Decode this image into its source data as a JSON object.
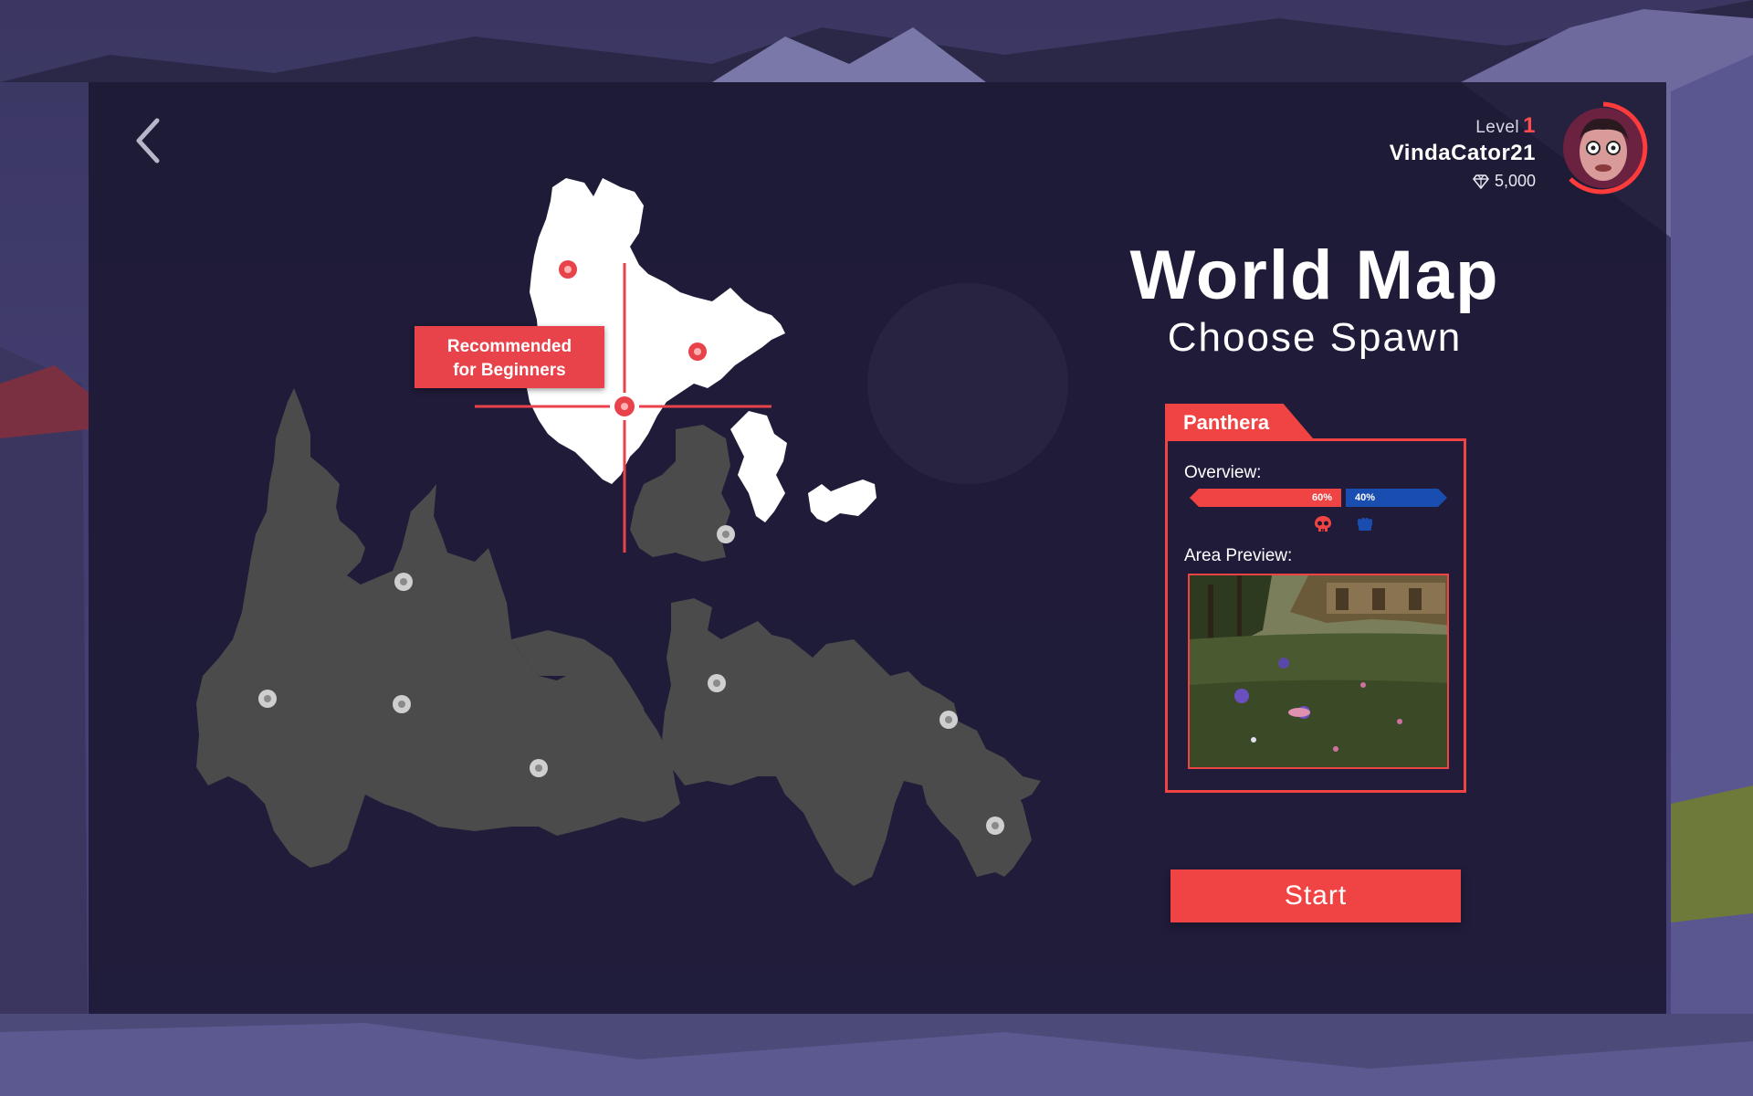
{
  "profile": {
    "level_label": "Level",
    "level_value": "1",
    "username": "VindaCator21",
    "gems": "5,000",
    "accent_color": "#ff4b4b"
  },
  "header": {
    "title": "World Map",
    "subtitle": "Choose Spawn"
  },
  "map": {
    "recommended_label_line1": "Recommended",
    "recommended_label_line2": "for Beginners",
    "selected_region_color": "#ffffff",
    "region_color": "#4b4b4b"
  },
  "region_card": {
    "name": "Panthera",
    "overview_label": "Overview:",
    "pvp_percent": "60%",
    "pve_percent": "40%",
    "pvp_fraction": 0.6,
    "pve_fraction": 0.4,
    "pvp_icon": "skull-icon",
    "pve_icon": "fist-icon",
    "preview_label": "Area Preview:"
  },
  "actions": {
    "start_label": "Start",
    "back_icon": "chevron-left-icon"
  },
  "colors": {
    "accent": "#f04343",
    "blue": "#1a4db0",
    "panel": "#1a1630"
  }
}
